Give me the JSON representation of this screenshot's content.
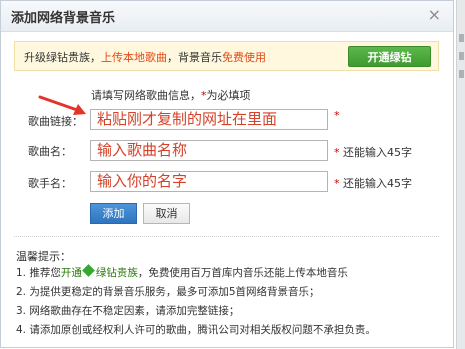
{
  "dialog": {
    "title": "添加网络背景音乐",
    "close_glyph": "×"
  },
  "promo": {
    "text_before": "升级绿钻贵族，",
    "link_upload": "上传本地歌曲",
    "text_middle": "，背景音乐",
    "link_free": "免费使用",
    "button_label": "开通绿钻"
  },
  "form": {
    "notice_prefix": "请填写网络歌曲信息，",
    "notice_req_mark": "*",
    "notice_suffix": "为必填项",
    "fields": [
      {
        "label": "歌曲链接：",
        "value": "粘贴刚才复制的网址在里面",
        "hint_mark": "*",
        "hint_text": ""
      },
      {
        "label": "歌曲名：",
        "value": "输入歌曲名称",
        "hint_mark": "*",
        "hint_text": "还能输入45字"
      },
      {
        "label": "歌手名：",
        "value": "输入你的名字",
        "hint_mark": "*",
        "hint_text": "还能输入45字"
      }
    ],
    "add_button": "添加",
    "cancel_button": "取消"
  },
  "tips": {
    "title": "温馨提示：",
    "line1_prefix": "1. 推荐您",
    "line1_link1": "开通",
    "line1_link2": "绿钻贵族",
    "line1_suffix": "，免费使用百万首库内音乐还能上传本地音乐",
    "line2": "2. 为提供更稳定的背景音乐服务，最多可添加5首网络背景音乐；",
    "line3": "3. 网络歌曲存在不稳定因素，请添加完整链接；",
    "line4": "4. 请添加原创或经权利人许可的歌曲，腾讯公司对相关版权问题不承担负责。"
  },
  "colors": {
    "accent_red": "#d4422a",
    "green_button": "#3f9a2f",
    "blue_button": "#2f74bf",
    "promo_bg": "#fff8df"
  }
}
